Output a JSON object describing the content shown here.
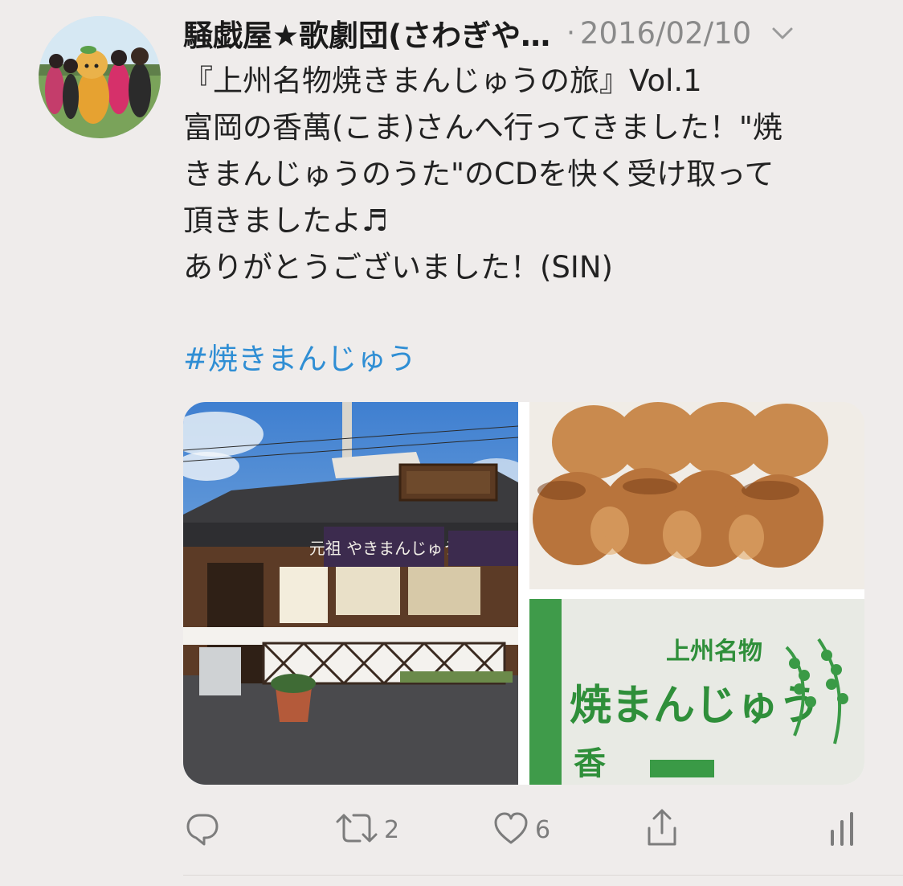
{
  "tweet": {
    "display_name": "騒戯屋★歌劇団(さわぎや…",
    "separator": "·",
    "date": "2016/02/10",
    "lines": [
      "『上州名物焼きまんじゅうの旅』Vol.1",
      "富岡の香萬(こま)さんへ行ってきました！\"焼",
      "きまんじゅうのうた\"のCDを快く受け取って",
      "頂きましたよ♬",
      "ありがとうございました！(SIN)"
    ],
    "hashtag": "#焼きまんじゅう",
    "photos": {
      "shop_sign": "元祖 やきまんじゅう",
      "bag_text_1": "上州名物",
      "bag_text_2": "焼まんじゅう",
      "bag_text_3": "香"
    }
  },
  "actions": {
    "reply_count": "",
    "retweet_count": "2",
    "like_count": "6",
    "share_count": "",
    "stats_count": ""
  },
  "icons": {
    "menu": "chevron-down-icon",
    "reply": "reply-icon",
    "retweet": "retweet-icon",
    "like": "heart-icon",
    "share": "share-icon",
    "stats": "analytics-icon"
  },
  "colors": {
    "background": "#efeceb",
    "hashtag": "#2f8ed4",
    "muted": "#8a8a8a",
    "text": "#222222"
  }
}
